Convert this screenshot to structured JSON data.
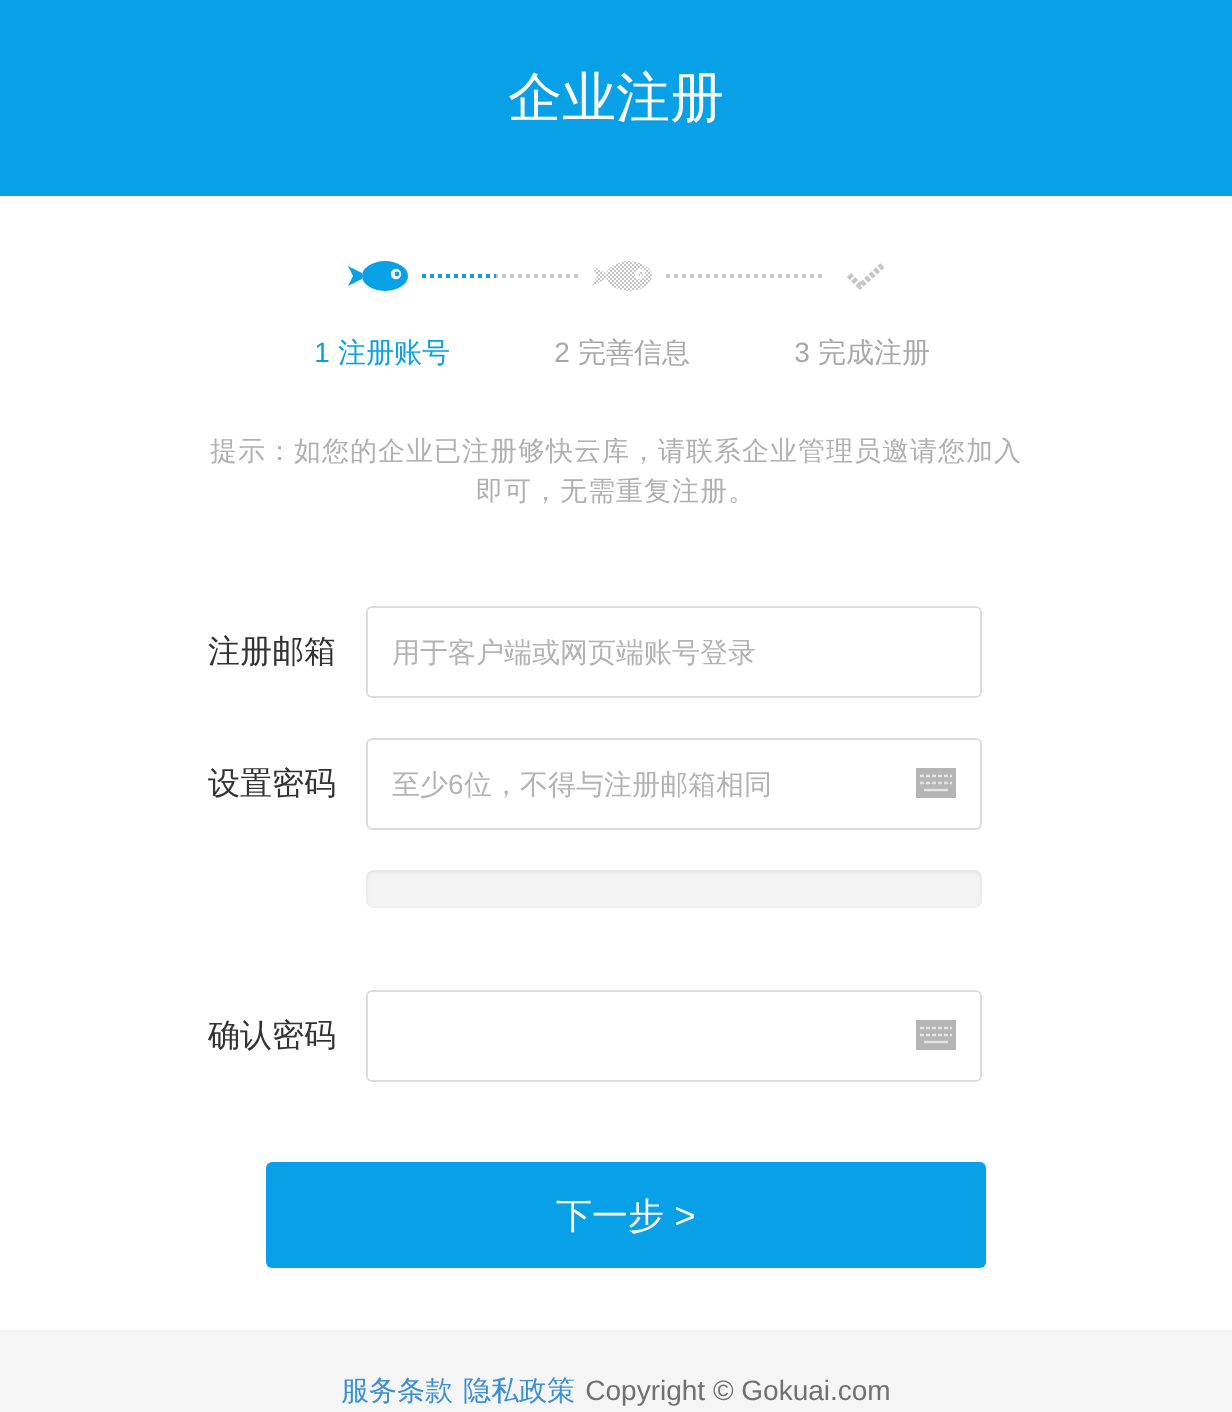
{
  "header": {
    "title": "企业注册"
  },
  "steps": [
    {
      "label": "1 注册账号",
      "selected": true
    },
    {
      "label": "2 完善信息",
      "selected": false
    },
    {
      "label": "3 完成注册",
      "selected": false
    }
  ],
  "hint": "提示：如您的企业已注册够快云库，请联系企业管理员邀请您加入即可，无需重复注册。",
  "form": {
    "fields": [
      {
        "label": "注册邮箱",
        "placeholder": "用于客户端或网页端账号登录",
        "kind": "text"
      },
      {
        "label": "设置密码",
        "placeholder": "至少6位，不得与注册邮箱相同",
        "kind": "password",
        "strength_bar": true
      },
      {
        "label": "确认密码",
        "kind": "password"
      }
    ]
  },
  "submit_button": "下一步 >",
  "footer": {
    "links": [
      "服务条款",
      "隐私政策"
    ],
    "copyright": "Copyright © Gokuai.com"
  }
}
